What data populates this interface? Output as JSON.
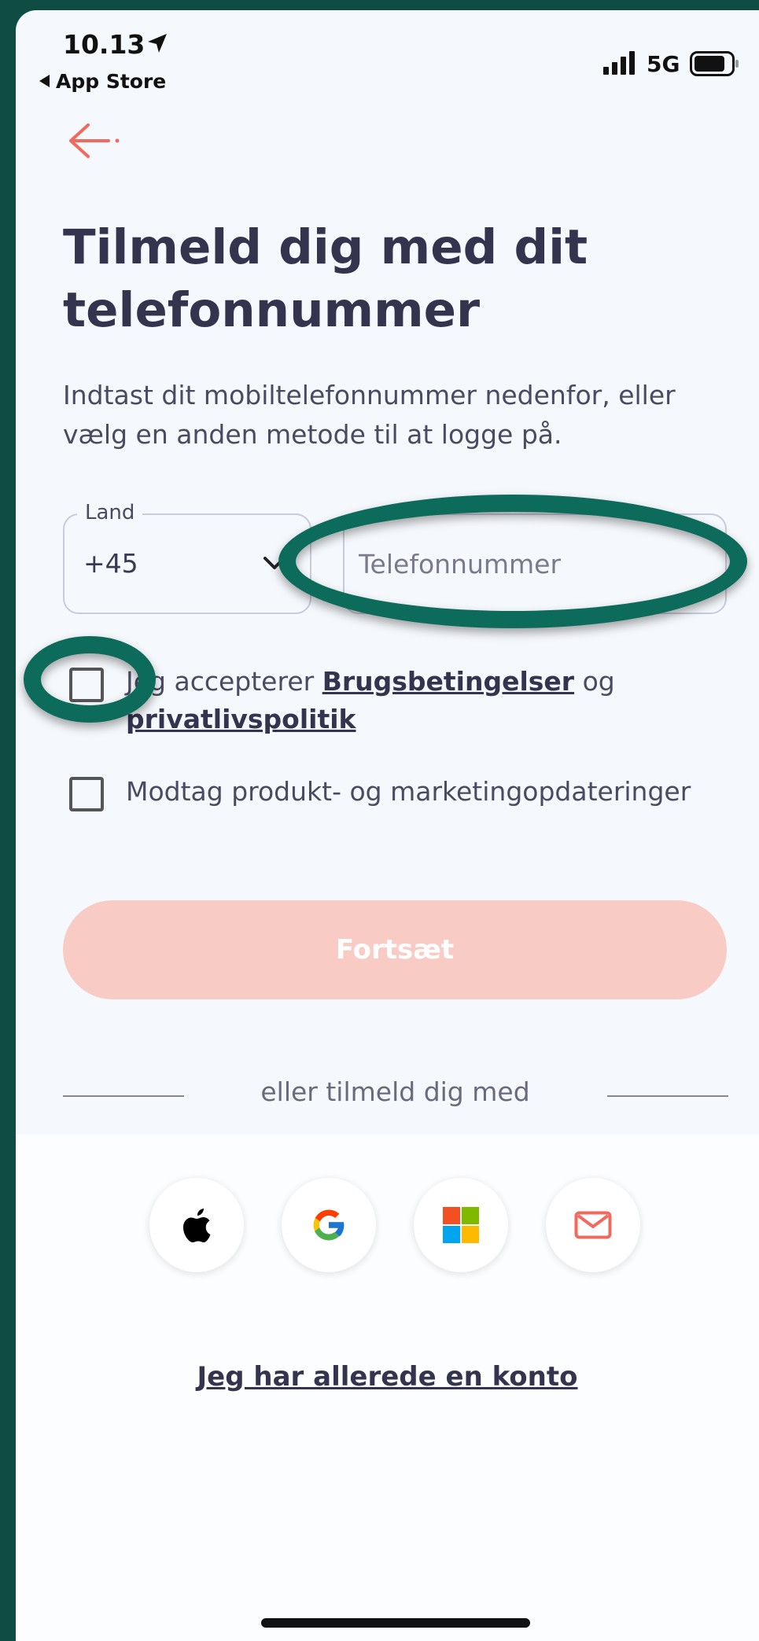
{
  "status_bar": {
    "time": "10.13",
    "back_app": "App Store",
    "network": "5G"
  },
  "header": {
    "title": "Tilmeld dig med dit telefonnummer",
    "subtitle": "Indtast dit mobiltelefonnummer nedenfor, eller vælg en anden metode til at logge på."
  },
  "form": {
    "country_label": "Land",
    "country_code": "+45",
    "phone_placeholder": "Telefonnummer",
    "phone_value": "",
    "terms": {
      "prefix": "Jeg accepterer ",
      "terms_link": "Brugsbetingelser",
      "conjunction": " og ",
      "privacy_link": "privatlivspolitik",
      "checked": false
    },
    "marketing": {
      "label": "Modtag produkt- og marketingopdateringer",
      "checked": false
    },
    "continue_label": "Fortsæt"
  },
  "divider_text": "eller tilmeld dig med",
  "social": [
    {
      "icon": "apple-icon"
    },
    {
      "icon": "google-icon"
    },
    {
      "icon": "microsoft-icon"
    },
    {
      "icon": "mail-icon"
    }
  ],
  "existing_account_link": "Jeg har allerede en konto",
  "colors": {
    "accent": "#f06a5e",
    "button_disabled": "#f8ccc5",
    "heading": "#35344f",
    "annotation": "#0d6b5b"
  }
}
